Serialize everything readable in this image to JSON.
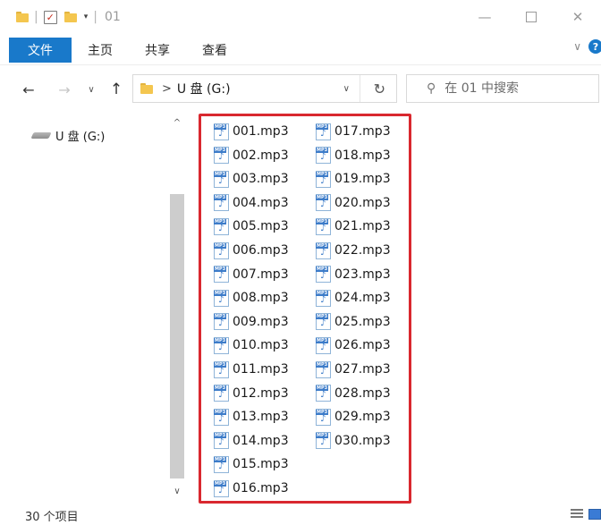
{
  "window": {
    "title_sep": "|",
    "title": "01",
    "controls": {
      "minimize": "—",
      "maximize": "",
      "close": "✕"
    }
  },
  "ribbon": {
    "tabs": [
      "文件",
      "主页",
      "共享",
      "查看"
    ],
    "collapse_icon": "∨",
    "help_icon": "?"
  },
  "nav": {
    "back": "←",
    "forward": "→",
    "recent": "∨",
    "up": "↑",
    "breadcrumb_sep": ">",
    "breadcrumb": "U 盘 (G:)",
    "address_dropdown": "∨",
    "refresh": "↻",
    "search_placeholder": "在 01 中搜索"
  },
  "sidebar": {
    "items": [
      {
        "label": "U 盘 (G:)",
        "icon": "usb-drive-icon"
      }
    ]
  },
  "scrollbar": {
    "up": "^",
    "down": "∨"
  },
  "files": [
    "001.mp3",
    "002.mp3",
    "003.mp3",
    "004.mp3",
    "005.mp3",
    "006.mp3",
    "007.mp3",
    "008.mp3",
    "009.mp3",
    "010.mp3",
    "011.mp3",
    "012.mp3",
    "013.mp3",
    "014.mp3",
    "015.mp3",
    "016.mp3",
    "017.mp3",
    "018.mp3",
    "019.mp3",
    "020.mp3",
    "021.mp3",
    "022.mp3",
    "023.mp3",
    "024.mp3",
    "025.mp3",
    "026.mp3",
    "027.mp3",
    "028.mp3",
    "029.mp3",
    "030.mp3"
  ],
  "status": {
    "count_text": "30 个项目"
  },
  "colors": {
    "accent": "#1979ca",
    "highlight_border": "#d9282f",
    "folder": "#f4c64f"
  }
}
